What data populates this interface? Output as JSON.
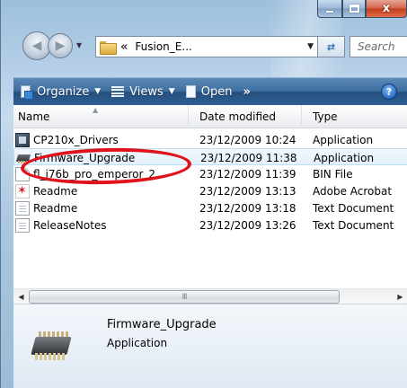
{
  "window": {
    "caption_buttons": {
      "minimize_icon": "minimize-icon",
      "maximize_icon": "maximize-icon",
      "close_glyph": "x"
    }
  },
  "navigation": {
    "address_chevrons": "«",
    "address_path": "Fusion_E...",
    "search_placeholder": "Search"
  },
  "command_bar": {
    "organize_label": "Organize",
    "views_label": "Views",
    "open_label": "Open",
    "more_label": "»",
    "help_label": "?"
  },
  "columns": {
    "name": "Name",
    "date_modified": "Date modified",
    "type": "Type"
  },
  "files": [
    {
      "name": "CP210x_Drivers",
      "date": "23/12/2009 10:24",
      "type": "Application",
      "icon": "application-icon"
    },
    {
      "name": "Firmware_Upgrade",
      "date": "23/12/2009 11:38",
      "type": "Application",
      "icon": "chip-icon"
    },
    {
      "name": "fl_i76b_pro_emperor_2...",
      "date": "23/12/2009 11:39",
      "type": "BIN File",
      "icon": "document-icon"
    },
    {
      "name": "Readme",
      "date": "23/12/2009 13:13",
      "type": "Adobe Acrobat",
      "icon": "pdf-icon"
    },
    {
      "name": "Readme",
      "date": "23/12/2009 13:18",
      "type": "Text Document",
      "icon": "text-icon"
    },
    {
      "name": "ReleaseNotes",
      "date": "23/12/2009 13:26",
      "type": "Text Document",
      "icon": "text-icon"
    }
  ],
  "scrollbar": {
    "grip": "III"
  },
  "details": {
    "name": "Firmware_Upgrade",
    "type": "Application"
  },
  "colors": {
    "highlight_ring": "#e0131c",
    "command_bar": "#2f5f92",
    "hover_row": "#e3f1fb"
  }
}
